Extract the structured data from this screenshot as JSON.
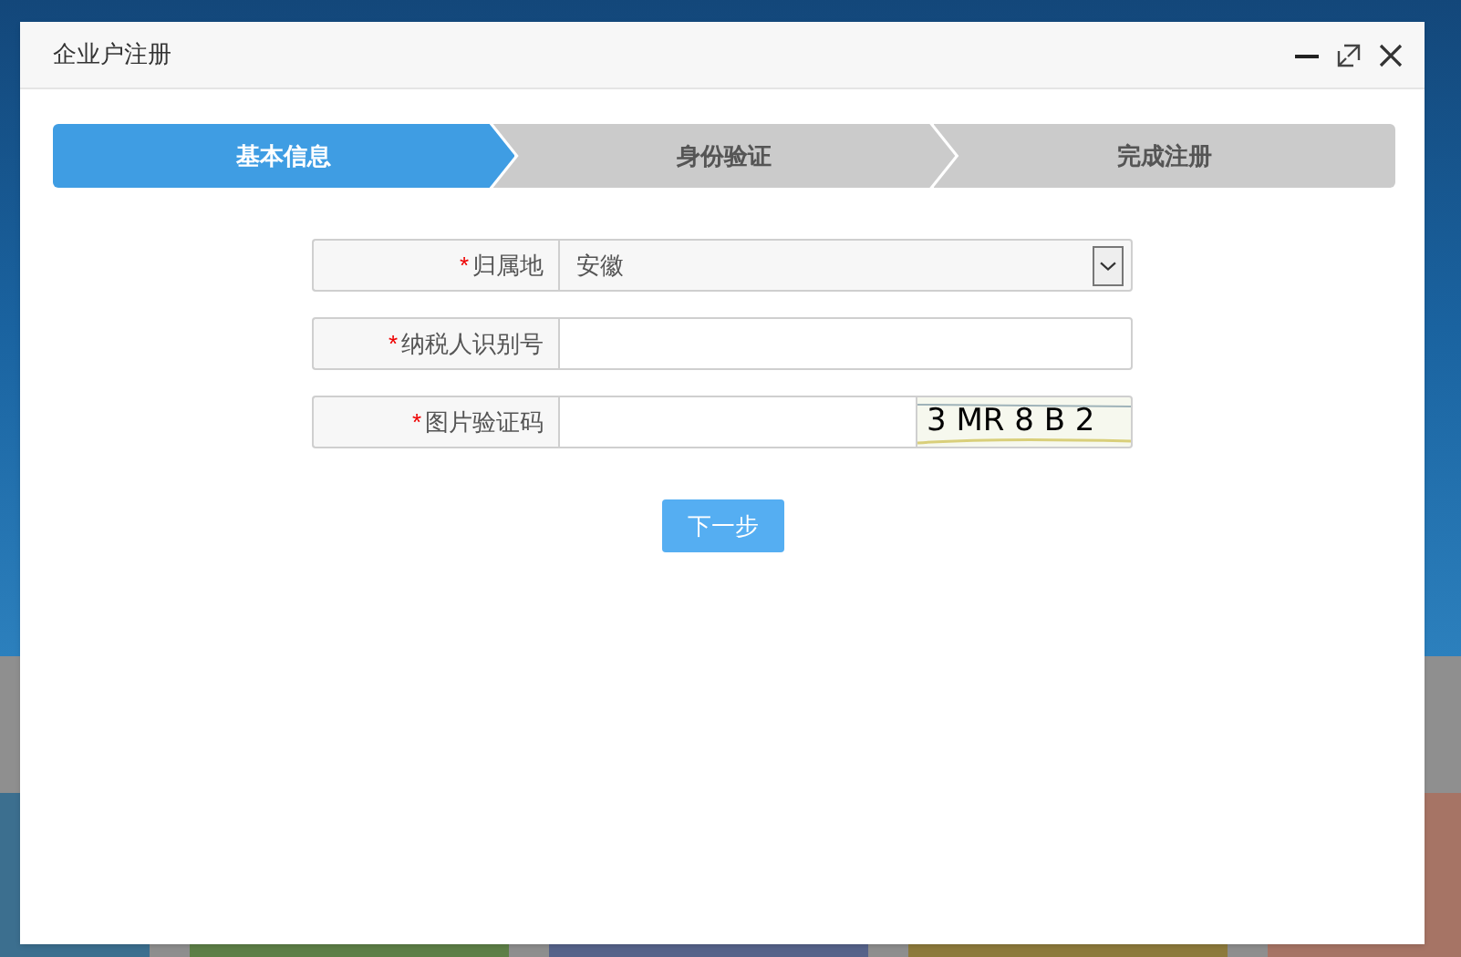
{
  "dialog": {
    "title": "企业户注册"
  },
  "steps": [
    {
      "label": "基本信息",
      "selected": true
    },
    {
      "label": "身份验证",
      "selected": false
    },
    {
      "label": "完成注册",
      "selected": false
    }
  ],
  "form": {
    "fields": [
      {
        "kind": "select",
        "label": "归属地",
        "mark": "*",
        "value": "安徽"
      },
      {
        "kind": "text",
        "label": "纳税人识别号",
        "mark": "*"
      },
      {
        "kind": "captcha",
        "label": "图片验证码",
        "mark": "*",
        "captcha": "3 MR 8 B 2"
      }
    ]
  },
  "next_button": "下一步"
}
